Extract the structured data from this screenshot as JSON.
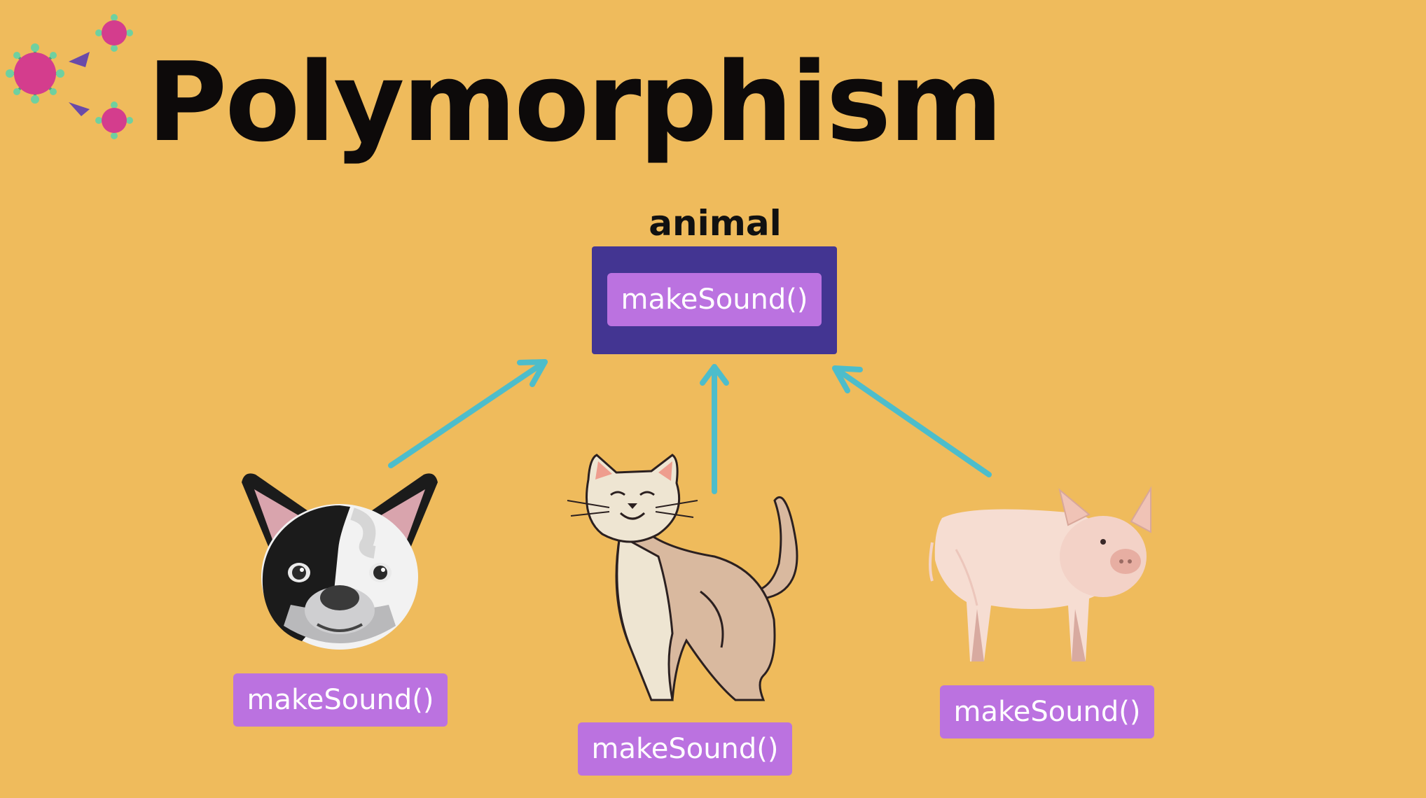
{
  "slide": {
    "title": "Polymorphism",
    "logo_icon": "molecule-icon"
  },
  "diagram": {
    "parent": {
      "label": "animal",
      "method": "makeSound()"
    },
    "children": [
      {
        "animal_icon": "dog-icon",
        "method": "makeSound()"
      },
      {
        "animal_icon": "cat-icon",
        "method": "makeSound()"
      },
      {
        "animal_icon": "pig-icon",
        "method": "makeSound()"
      }
    ],
    "colors": {
      "background": "#efbb5c",
      "parent_box": "#433592",
      "method_chip": "#bb72e0",
      "arrow": "#4dbdcb"
    }
  }
}
